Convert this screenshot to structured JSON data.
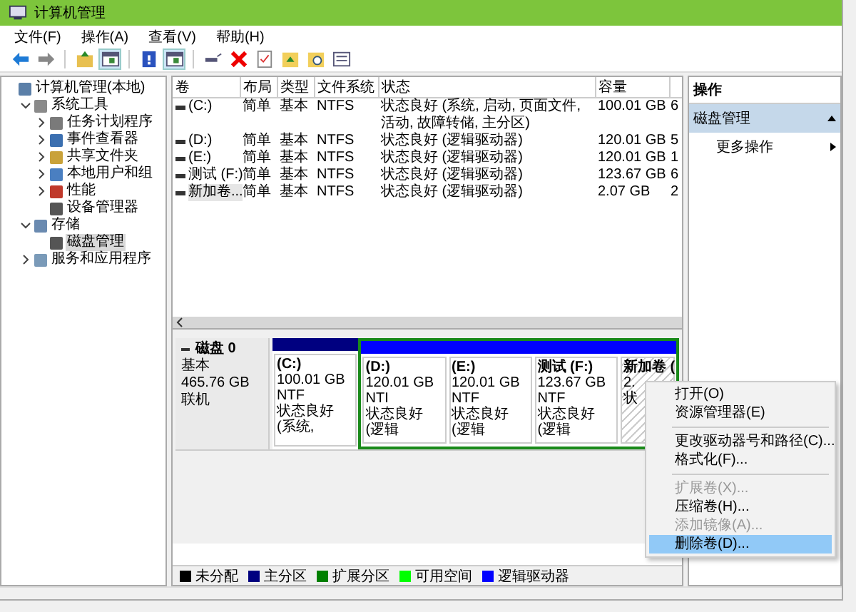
{
  "window": {
    "title": "计算机管理"
  },
  "menu": [
    "文件(F)",
    "操作(A)",
    "查看(V)",
    "帮助(H)"
  ],
  "toolbar": [
    {
      "kind": "back",
      "disabled": false
    },
    {
      "kind": "forward",
      "disabled": true
    },
    {
      "kind": "sep"
    },
    {
      "kind": "up"
    },
    {
      "kind": "panel",
      "selected": true
    },
    {
      "kind": "sep"
    },
    {
      "kind": "help"
    },
    {
      "kind": "panel",
      "selected": true
    },
    {
      "kind": "sep"
    },
    {
      "kind": "connect"
    },
    {
      "kind": "delete"
    },
    {
      "kind": "check"
    },
    {
      "kind": "folder-up"
    },
    {
      "kind": "folder-search"
    },
    {
      "kind": "list"
    }
  ],
  "tree": [
    {
      "label": "计算机管理(本地)",
      "selected": false,
      "children": [
        {
          "label": "系统工具",
          "expanded": true,
          "selected": false,
          "children": [
            {
              "label": "任务计划程序",
              "expanded": false,
              "selected": false
            },
            {
              "label": "事件查看器",
              "expanded": false,
              "selected": false
            },
            {
              "label": "共享文件夹",
              "expanded": false,
              "selected": false
            },
            {
              "label": "本地用户和组",
              "expanded": false,
              "selected": false
            },
            {
              "label": "性能",
              "expanded": false,
              "selected": false
            },
            {
              "label": "设备管理器",
              "selected": false
            }
          ]
        },
        {
          "label": "存储",
          "expanded": true,
          "selected": false,
          "children": [
            {
              "label": "磁盘管理",
              "selected": true
            }
          ]
        },
        {
          "label": "服务和应用程序",
          "expanded": false,
          "selected": false
        }
      ]
    }
  ],
  "table": {
    "columns": [
      "卷",
      "布局",
      "类型",
      "文件系统",
      "状态",
      "容量"
    ],
    "rows": [
      {
        "cells": [
          "(C:)",
          "简单",
          "基本",
          "NTFS",
          "状态良好 (系统, 启动, 页面文件, 活动, 故障转储, 主分区)",
          "100.01 GB",
          "6"
        ],
        "selected": false
      },
      {
        "cells": [
          "(D:)",
          "简单",
          "基本",
          "NTFS",
          "状态良好 (逻辑驱动器)",
          "120.01 GB",
          "5"
        ],
        "selected": false
      },
      {
        "cells": [
          "(E:)",
          "简单",
          "基本",
          "NTFS",
          "状态良好 (逻辑驱动器)",
          "120.01 GB",
          "1"
        ],
        "selected": false
      },
      {
        "cells": [
          "测试 (F:)",
          "简单",
          "基本",
          "NTFS",
          "状态良好 (逻辑驱动器)",
          "123.67 GB",
          "6"
        ],
        "selected": false
      },
      {
        "cells": [
          "新加卷...",
          "简单",
          "基本",
          "NTFS",
          "状态良好 (逻辑驱动器)",
          "2.07 GB",
          "2"
        ],
        "selected": true
      }
    ]
  },
  "disk": {
    "name": "磁盘 0",
    "type": "基本",
    "size": "465.76 GB",
    "status": "联机",
    "partitions": [
      {
        "name": "(C:)",
        "size": "100.01 GB NTF",
        "status": "状态良好 (系统,",
        "color": "#000080",
        "extended": false,
        "selected": false
      },
      {
        "name": "(D:)",
        "size": "120.01 GB NTI",
        "status": "状态良好 (逻辑",
        "color": "#0000ff",
        "extended": true,
        "selected": false
      },
      {
        "name": "(E:)",
        "size": "120.01 GB NTF",
        "status": "状态良好 (逻辑",
        "color": "#0000ff",
        "extended": true,
        "selected": false
      },
      {
        "name": "测试  (F:)",
        "size": "123.67 GB NTF",
        "status": "状态良好 (逻辑",
        "color": "#0000ff",
        "extended": true,
        "selected": false
      },
      {
        "name": "新加卷 (",
        "size": "2.",
        "status": "状",
        "color": "#0000ff",
        "extended": true,
        "selected": true
      }
    ]
  },
  "legend": [
    {
      "label": "未分配",
      "color": "#000000"
    },
    {
      "label": "主分区",
      "color": "#000080"
    },
    {
      "label": "扩展分区",
      "color": "#008000"
    },
    {
      "label": "可用空间",
      "color": "#00ff00"
    },
    {
      "label": "逻辑驱动器",
      "color": "#0000ff"
    }
  ],
  "actions": {
    "title": "操作",
    "section": "磁盘管理",
    "items": [
      "更多操作"
    ]
  },
  "context_menu": [
    {
      "label": "打开(O)",
      "disabled": false,
      "selected": false
    },
    {
      "label": "资源管理器(E)",
      "disabled": false,
      "selected": false
    },
    {
      "kind": "sep"
    },
    {
      "label": "更改驱动器号和路径(C)...",
      "disabled": false,
      "selected": false
    },
    {
      "label": "格式化(F)...",
      "disabled": false,
      "selected": false
    },
    {
      "kind": "sep"
    },
    {
      "label": "扩展卷(X)...",
      "disabled": true,
      "selected": false
    },
    {
      "label": "压缩卷(H)...",
      "disabled": false,
      "selected": false
    },
    {
      "label": "添加镜像(A)...",
      "disabled": true,
      "selected": false
    },
    {
      "label": "删除卷(D)...",
      "disabled": false,
      "selected": true
    }
  ]
}
